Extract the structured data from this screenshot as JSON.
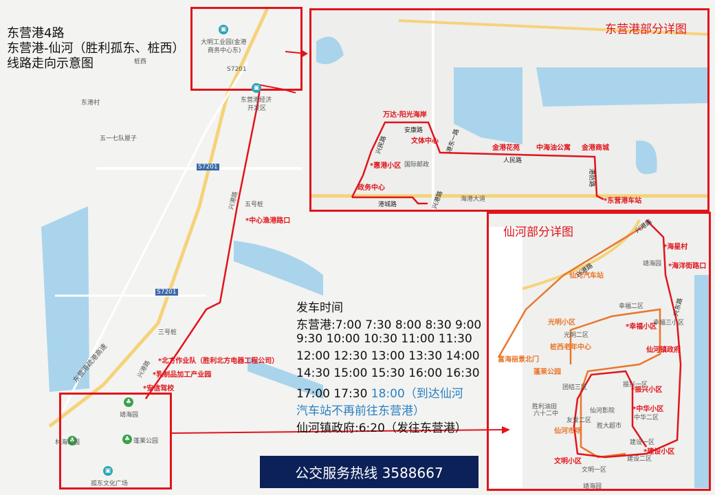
{
  "title": {
    "line1": "东营港4路",
    "line2": "东营港-仙河（胜利孤东、桩西）",
    "line3": "线路走向示意图"
  },
  "panels": {
    "dongying_detail": "东营港部分详图",
    "xianhe_detail": "仙河部分详图"
  },
  "schedule": {
    "heading": "发车时间",
    "line1": "东营港:7:00 7:30 8:00 8:30 9:00",
    "line2": "9:30 10:00 10:30 11:00 11:30",
    "line3": "12:00 12:30 13:00 13:30 14:00",
    "line4": "14:30 15:00 15:30 16:00 16:30",
    "line5_prefix": "17:00 17:30 ",
    "line5_highlight": "18:00（到达仙河",
    "line6_highlight": "汽车站不再前往东营港）",
    "line7": "仙河镇政府:6:20（发往东营港）"
  },
  "hotline": "公交服务热线  3588667",
  "main_map": {
    "stops": [
      "*中心渔港路口",
      "*北方作业队（胜利北方电器工程公司）",
      "*乳制品加工产业园",
      "*安信驾校"
    ],
    "labels": {
      "industrial_park_a": "大明工业园(金港",
      "industrial_park_b": "商务中心东)",
      "econ_zone_a": "东营港经济",
      "econ_zone_b": "开发区",
      "zhuangxi": "桩西",
      "dongganggcun": "东港村",
      "wuyiqi": "五一七队屋子",
      "wuhaozhuang": "五号桩",
      "sanhaozhuang": "三号桩",
      "jinghaiyuan": "靖海园",
      "linhai_park": "林海公园",
      "penglai_park": "蓬莱公园",
      "gudong_square": "孤东文化广场",
      "s7201_a": "S7201",
      "s7201_b": "S7201",
      "s7201_c": "S7201",
      "road_xinggang": "兴港路",
      "road_xinggang_2": "兴港路",
      "expressway": "东营港疏港高速",
      "road_mark": "S7201"
    }
  },
  "dongying_map": {
    "stops": [
      "万达·阳光海岸",
      "安康路",
      "文体中心",
      "*惠港小区",
      "政务中心",
      "金港花苑",
      "中海油公寓",
      "金港商城",
      "*东营港车站"
    ],
    "roads": [
      "兴民路",
      "港东一路",
      "人民路",
      "港城路",
      "港防路",
      "兴港路"
    ],
    "labels": {
      "gov": "国际邮政",
      "ave": "海港大道"
    }
  },
  "xianhe_map": {
    "stops": [
      "*海星村",
      "*海洋街路口",
      "仙河汽车站",
      "光明小区",
      "*幸福小区",
      "桩西老年中心",
      "仙河镇政府",
      "富海丽景北门",
      "蓬莱公园",
      "*振兴小区",
      "*中华小区",
      "仙河市场",
      "*建设小区",
      "文明小区"
    ],
    "roads": [
      "兴港路",
      "兴港路",
      "兴东路"
    ],
    "labels": {
      "jinghai": "靖海园",
      "xingfu2": "幸福二区",
      "xingfu3": "幸福三小区",
      "guangming2": "光明二区",
      "zhenxing1": "振兴一区",
      "zhonghua2": "中华二区",
      "tuanjie3": "团结三区",
      "shengli": "胜利油田",
      "liushier": "六十二中",
      "youai": "友爱二区",
      "shengda": "胜大超市",
      "jianshe1": "建设一区",
      "jianshe2": "建设二区",
      "wenming1": "文明一区",
      "jinghaiyuan": "靖海园",
      "xianhe_cinema": "仙河影院"
    }
  },
  "colors": {
    "route_red": "#e0141b",
    "route_orange": "#e8762b",
    "water": "#a9d4ec",
    "hotline_bg": "#0c2157"
  }
}
